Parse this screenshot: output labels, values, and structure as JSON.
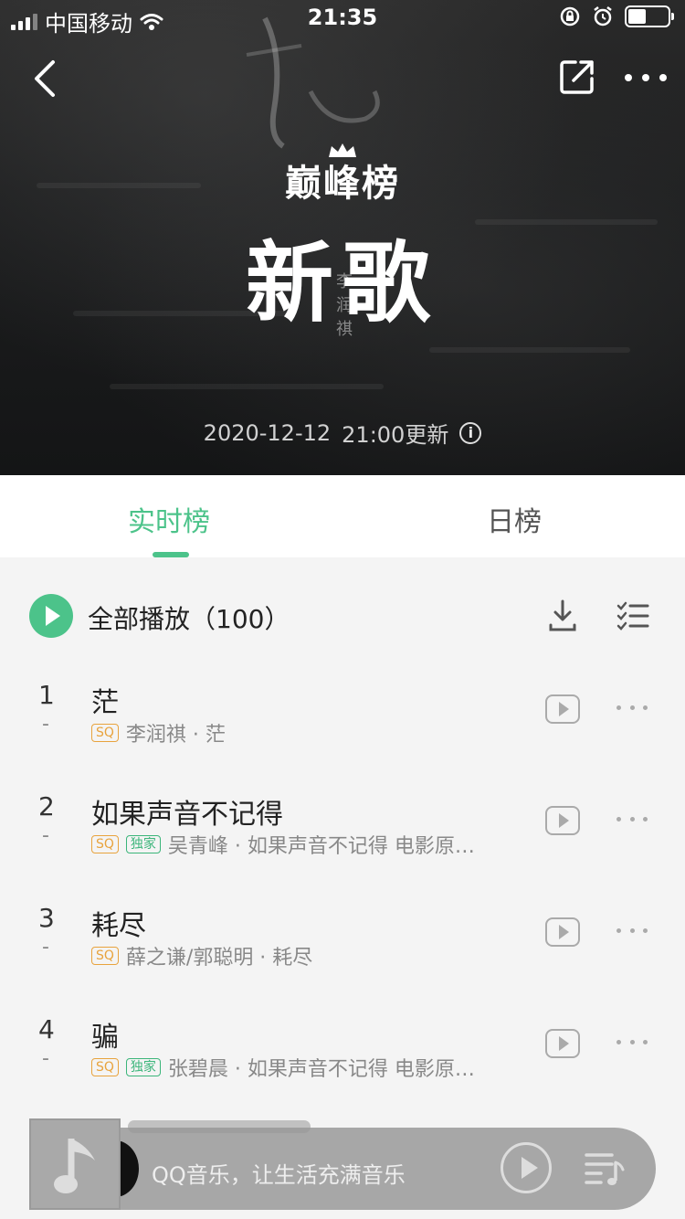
{
  "status_bar": {
    "carrier": "中国移动",
    "time": "21:35"
  },
  "hero": {
    "brand": "巅峰榜",
    "title": "新歌",
    "watermark": [
      "李",
      "润",
      "祺"
    ],
    "update_date": "2020-12-12",
    "update_time": "21:00更新"
  },
  "tabs": [
    {
      "label": "实时榜",
      "active": true
    },
    {
      "label": "日榜",
      "active": false
    }
  ],
  "list_header": {
    "play_all": "全部播放（100）"
  },
  "songs": [
    {
      "rank": "1",
      "trend": "-",
      "title": "茫",
      "badges": [
        "SQ"
      ],
      "meta": "李润祺 · 茫"
    },
    {
      "rank": "2",
      "trend": "-",
      "title": "如果声音不记得",
      "badges": [
        "SQ",
        "独家"
      ],
      "meta": "吴青峰 · 如果声音不记得 电影原…"
    },
    {
      "rank": "3",
      "trend": "-",
      "title": "耗尽",
      "badges": [
        "SQ"
      ],
      "meta": "薛之谦/郭聪明 · 耗尽"
    },
    {
      "rank": "4",
      "trend": "-",
      "title": "骗",
      "badges": [
        "SQ",
        "独家"
      ],
      "meta": "张碧晨 · 如果声音不记得 电影原…"
    }
  ],
  "mini_player": {
    "text": "QQ音乐，让生活充满音乐"
  },
  "colors": {
    "accent": "#4cc38a",
    "sq_badge": "#e8a33d",
    "exclusive_badge": "#3bb57a"
  },
  "icons": [
    "chevron-left-icon",
    "share-icon",
    "more-icon",
    "info-icon",
    "play-icon",
    "download-icon",
    "multiselect-icon",
    "mv-icon",
    "music-note-icon",
    "playlist-icon"
  ]
}
